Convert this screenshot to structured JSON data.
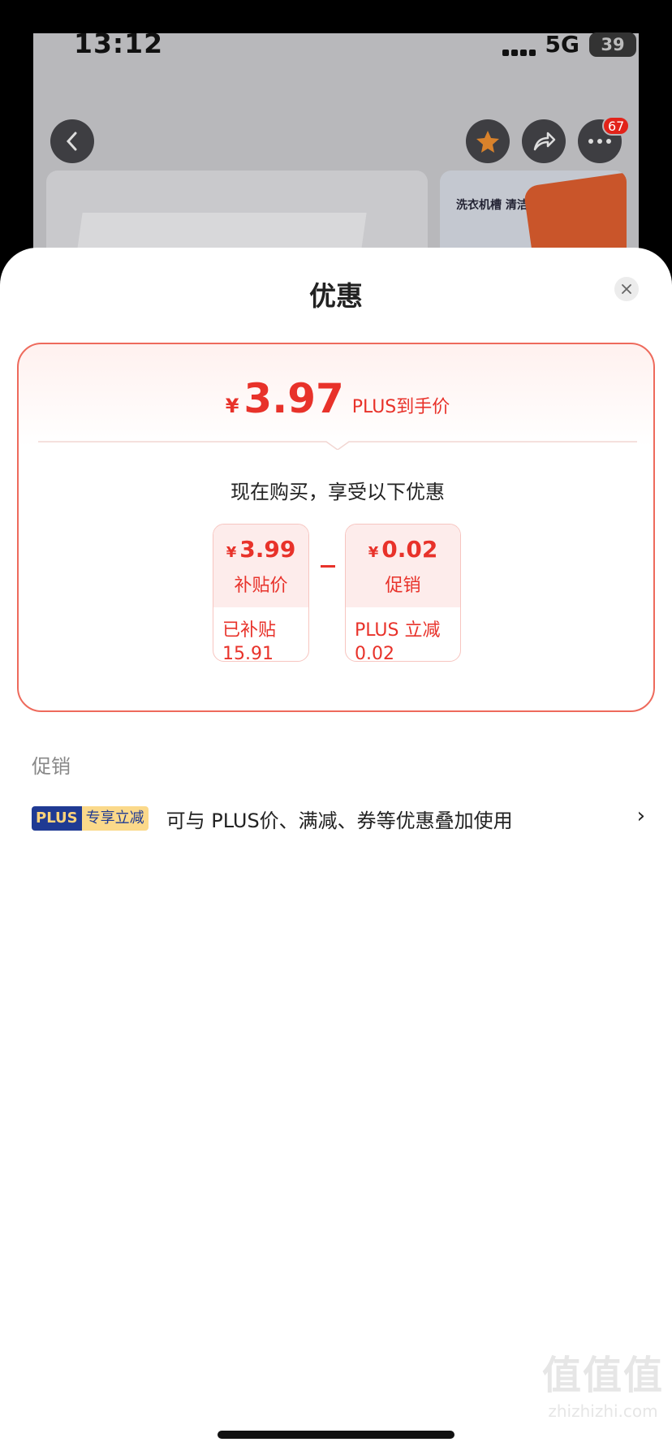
{
  "status_bar": {
    "time": "13:12",
    "network": "5G",
    "battery": "39"
  },
  "background": {
    "cart_badge": "67",
    "banner_tag": "洗衣机槽 清洁"
  },
  "sheet": {
    "title": "优惠",
    "price": {
      "currency": "¥",
      "amount": "3.97",
      "tag": "PLUS到手价"
    },
    "subtitle": "现在购买，享受以下优惠",
    "breakdown": [
      {
        "currency": "¥",
        "value": "3.99",
        "label": "补贴价",
        "detail_line1": "已补贴",
        "detail_line2": "15.91"
      },
      {
        "currency": "¥",
        "value": "0.02",
        "label": "促销",
        "detail_line1": "PLUS 立减",
        "detail_line2": "0.02"
      }
    ],
    "section_label": "促销",
    "promo": {
      "badge_plus": "PLUS",
      "badge_text": "专享立减",
      "description": "可与 PLUS价、满减、券等优惠叠加使用",
      "chevron": "›"
    }
  },
  "watermark": {
    "mark": "值值值",
    "url": "zhizhizhi.com"
  },
  "colors": {
    "accent": "#e8322a",
    "plus_blue": "#1f3a93",
    "plus_gold": "#fbd98a"
  }
}
